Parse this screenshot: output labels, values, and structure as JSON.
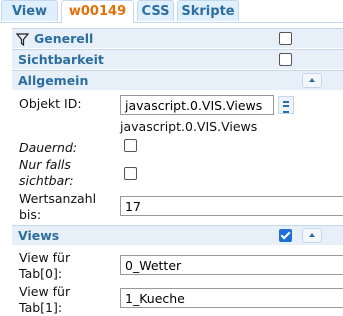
{
  "tabs": [
    {
      "label": "View"
    },
    {
      "label": "w00149",
      "active": true
    },
    {
      "label": "CSS"
    },
    {
      "label": "Skripte"
    }
  ],
  "sections": {
    "generell": {
      "title": "Generell",
      "checked": false
    },
    "sichtbarkeit": {
      "title": "Sichtbarkeit",
      "checked": false
    },
    "allgemein": {
      "title": "Allgemein"
    },
    "views": {
      "title": "Views",
      "checked": true
    }
  },
  "fields": {
    "objekt_id": {
      "label": "Objekt ID:",
      "value": "javascript.0.VIS.Views",
      "hint": "javascript.0.VIS.Views"
    },
    "dauernd": {
      "label": "Dauernd:",
      "checked": false
    },
    "nur_falls_sichtbar": {
      "label_line1": "Nur falls",
      "label_line2": "sichtbar:",
      "checked": false
    },
    "wertsanzahl": {
      "label_line1": "Wertsanzahl",
      "label_line2": "bis:",
      "value": "17"
    },
    "view_tab0": {
      "label_line1": "View für",
      "label_line2": "Tab[0]:",
      "value": "0_Wetter"
    },
    "view_tab1": {
      "label_line1": "View für",
      "label_line2": "Tab[1]:",
      "value": "1_Kueche"
    }
  },
  "colors": {
    "tab_text": "#2e6e9e",
    "active_tab_text": "#e17009",
    "section_bg": "#e7eff8",
    "checkbox_checked": "#1f6fd6"
  }
}
